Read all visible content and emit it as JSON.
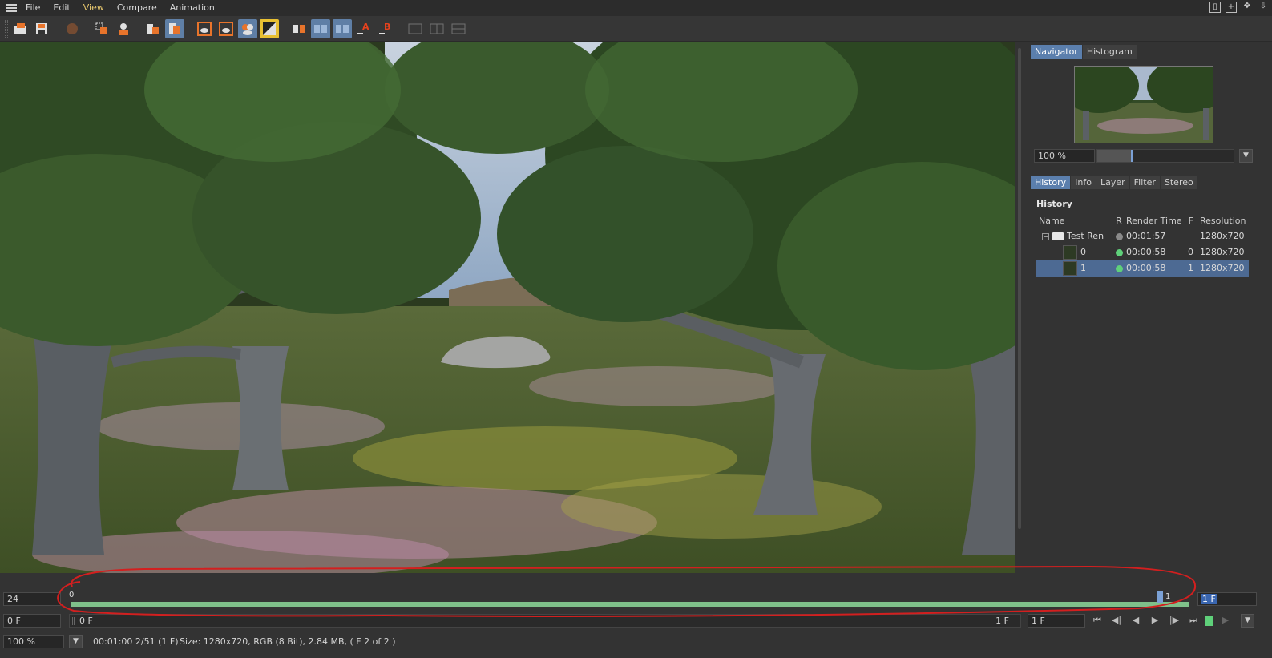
{
  "menu": {
    "items": [
      "File",
      "Edit",
      "View",
      "Compare",
      "Animation"
    ],
    "active_index": 2
  },
  "window_controls": [
    "panel-toggle-icon",
    "add-panel-icon",
    "move-panel-icon",
    "drag-panel-icon"
  ],
  "toolbar": {
    "buttons": [
      {
        "name": "open-image-icon",
        "state": "normal"
      },
      {
        "name": "save-image-icon",
        "state": "normal"
      },
      {
        "name": "stop-render-icon",
        "state": "disabled"
      },
      {
        "name": "render-region-icon",
        "state": "normal"
      },
      {
        "name": "render-active-icon",
        "state": "normal"
      },
      {
        "name": "remove-image-icon",
        "state": "normal"
      },
      {
        "name": "remove-all-icon",
        "state": "normal"
      },
      {
        "name": "view-rgb-icon",
        "state": "normal"
      },
      {
        "name": "view-alpha-icon",
        "state": "normal"
      },
      {
        "name": "view-stereo-icon",
        "state": "on"
      },
      {
        "name": "view-compare-icon",
        "state": "normal"
      },
      {
        "name": "ab-compare-icon",
        "state": "normal"
      },
      {
        "name": "ab-split-icon",
        "state": "on"
      },
      {
        "name": "ab-swap-icon",
        "state": "on"
      },
      {
        "name": "set-a-icon",
        "state": "normal"
      },
      {
        "name": "set-b-icon",
        "state": "normal"
      },
      {
        "name": "layout-1-icon",
        "state": "disabled"
      },
      {
        "name": "layout-2-icon",
        "state": "disabled"
      },
      {
        "name": "layout-3-icon",
        "state": "disabled"
      }
    ]
  },
  "navigator": {
    "tabs": [
      "Navigator",
      "Histogram"
    ],
    "active_tab": 0,
    "zoom": "100 %",
    "zoom_level": 0.25
  },
  "history_panel": {
    "tabs": [
      "History",
      "Info",
      "Layer",
      "Filter",
      "Stereo"
    ],
    "active_tab": 0,
    "title": "History",
    "columns": [
      "Name",
      "R",
      "Render Time",
      "F",
      "Resolution"
    ],
    "rows": [
      {
        "name": "Test Ren",
        "status_color": "#8a8a8a",
        "time": "00:01:57",
        "frame": "",
        "resolution": "1280x720",
        "kind": "folder",
        "selected": false
      },
      {
        "name": "0",
        "status_color": "#5fd07a",
        "time": "00:00:58",
        "frame": "0",
        "resolution": "1280x720",
        "kind": "image",
        "selected": false
      },
      {
        "name": "1",
        "status_color": "#5fd07a",
        "time": "00:00:58",
        "frame": "1",
        "resolution": "1280x720",
        "kind": "image",
        "selected": true
      }
    ]
  },
  "timeline": {
    "fps": "24",
    "track_start_label": "0",
    "track_end_label": "1",
    "current_frame": "1 F",
    "range_start": "0 F",
    "range_end": "1 F",
    "left_frame": "0 F",
    "frame_unit": "1 F",
    "controls": [
      "go-start-icon",
      "prev-key-icon",
      "play-backward-icon",
      "play-forward-icon",
      "next-key-icon",
      "go-end-icon",
      "loop-icon",
      "record-icon"
    ]
  },
  "status": {
    "zoom": "100 %",
    "time": "00:01:00 2/51 (1 F)",
    "info": "Size: 1280x720, RGB (8 Bit), 2.84 MB,  ( F 2 of 2 )"
  },
  "colors": {
    "accent": "#5b7fad",
    "annotation": "#d31f1f",
    "timeline_bar": "#7fc08a"
  }
}
